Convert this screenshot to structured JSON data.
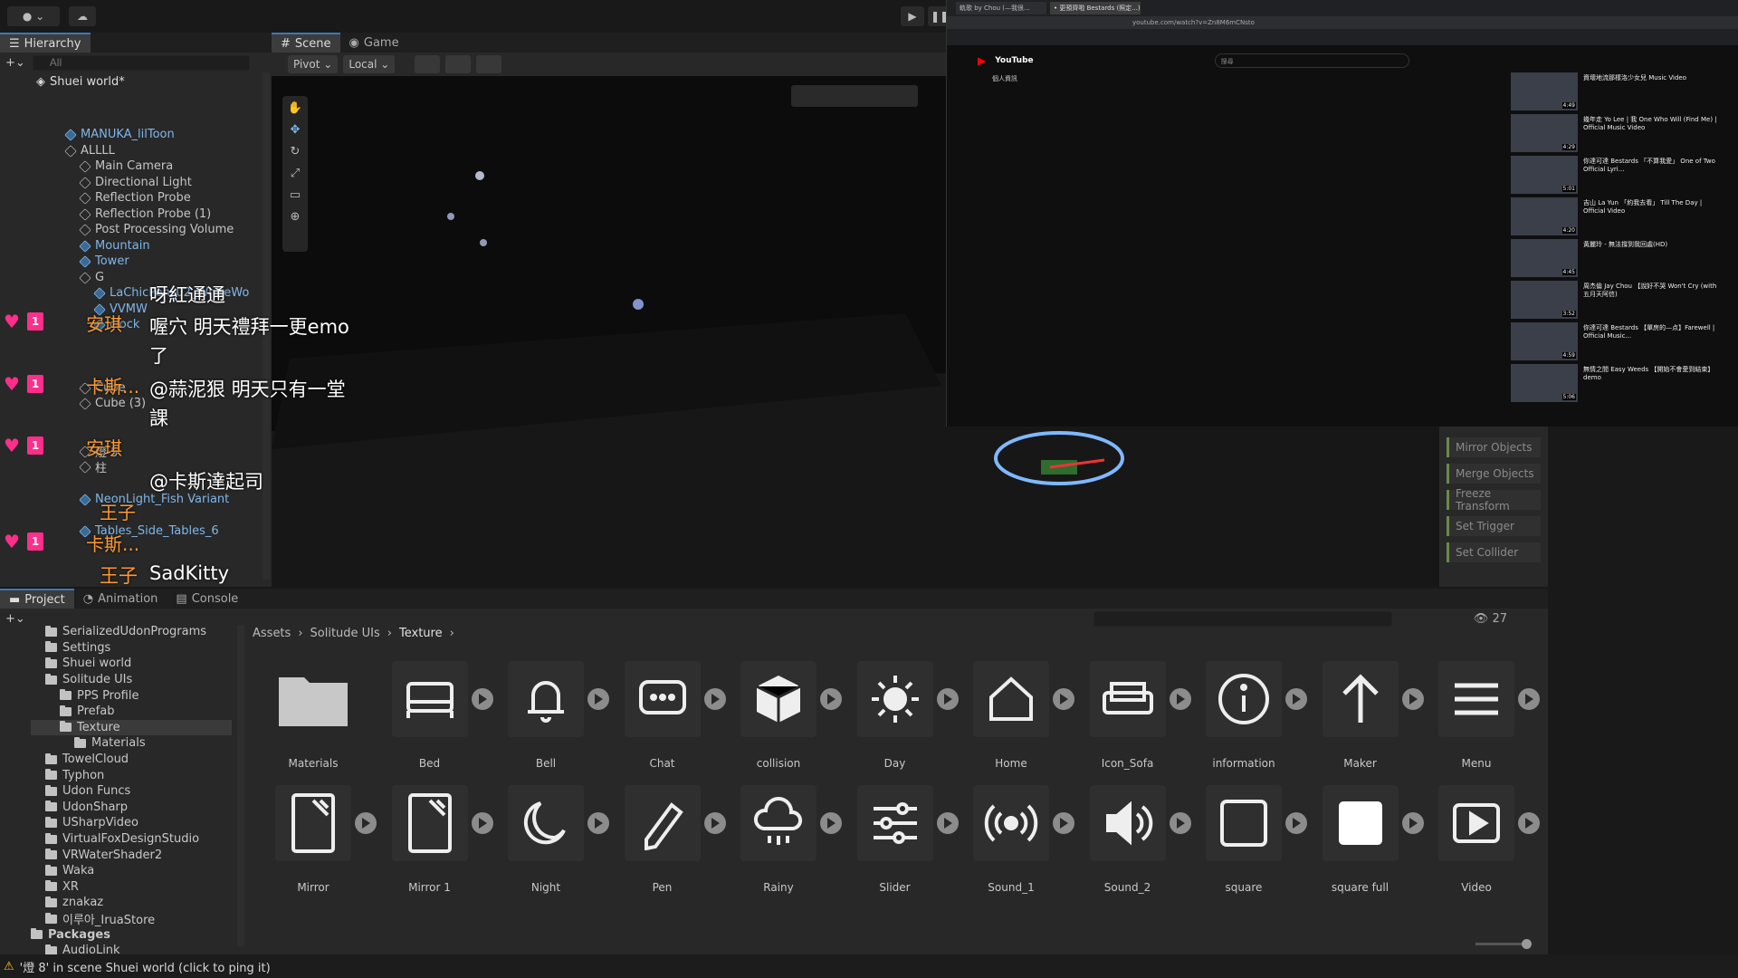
{
  "toolbar": {
    "play_icon": "play-icon",
    "pause_icon": "pause-icon"
  },
  "hierarchy": {
    "tab_label": "Hierarchy",
    "search_placeholder": "All",
    "scene_name": "Shuei world*",
    "rows": [
      {
        "label": "MANUKA_lilToon",
        "indent": 1,
        "prefab": true
      },
      {
        "label": "ALLLL",
        "indent": 1,
        "prefab": false
      },
      {
        "label": "Main Camera",
        "indent": 2,
        "prefab": false
      },
      {
        "label": "Directional Light",
        "indent": 2,
        "prefab": false
      },
      {
        "label": "Reflection Probe",
        "indent": 2,
        "prefab": false
      },
      {
        "label": "Reflection Probe (1)",
        "indent": 2,
        "prefab": false
      },
      {
        "label": "Post Processing Volume",
        "indent": 2,
        "prefab": false
      },
      {
        "label": "Mountain",
        "indent": 2,
        "prefab": true
      },
      {
        "label": "Tower",
        "indent": 2,
        "prefab": true
      },
      {
        "label": "G",
        "indent": 2,
        "prefab": false
      },
      {
        "label": "LaChicPen_02_WhiteWo",
        "indent": 3,
        "prefab": true
      },
      {
        "label": "VVMW",
        "indent": 3,
        "prefab": true
      },
      {
        "label": "clock",
        "indent": 3,
        "prefab": true
      },
      {
        "label": "Cube",
        "indent": 2,
        "prefab": false
      },
      {
        "label": "Cube (3)",
        "indent": 2,
        "prefab": false
      },
      {
        "label": "燈 5",
        "indent": 2,
        "prefab": false
      },
      {
        "label": "柱",
        "indent": 2,
        "prefab": false
      },
      {
        "label": "NeonLight_Fish Variant",
        "indent": 2,
        "prefab": true
      },
      {
        "label": "Tables_Side_Tables_6",
        "indent": 2,
        "prefab": true
      }
    ]
  },
  "chat": [
    {
      "name": "",
      "text": "呀紅通通"
    },
    {
      "name": "安琪",
      "text": "喔穴 明天禮拜一更emo"
    },
    {
      "name": "",
      "text": "了"
    },
    {
      "name": "卡斯...",
      "text": "@蒜泥狠 明天只有一堂"
    },
    {
      "name": "",
      "text": "課"
    },
    {
      "name": "安琪",
      "text": ""
    },
    {
      "name": "",
      "text": "@卡斯達起司"
    },
    {
      "name": "王子",
      "text": ""
    },
    {
      "name": "卡斯...",
      "text": ""
    },
    {
      "name": "王子",
      "text": "SadKitty"
    }
  ],
  "scene": {
    "tab_scene": "Scene",
    "tab_game": "Game",
    "pivot": "Pivot",
    "local": "Local"
  },
  "youtube": {
    "url": "youtube.com/watch?v=Zn8M6mCNsto",
    "tab1": "軌歌 by Chou (—我很...",
    "tab2": "• 更預齊啦 Bestards (照定...)",
    "logo": "YouTube",
    "search_placeholder": "搜尋",
    "description_title": "個人資訊",
    "videos": [
      {
        "title": "資壞地流那樣洛少女兒 Music Video",
        "duration": "4:49"
      },
      {
        "title": "幾年走 Yo Lee | 我 One Who Will (Find Me) | Official Music Video",
        "duration": "4:29"
      },
      {
        "title": "你達可達 Bestards 「不算我愛」 One of Two Official Lyri...",
        "duration": "5:01"
      },
      {
        "title": "吉山 La Yun 「約我去看」 Till The Day | Official Video",
        "duration": "4:20"
      },
      {
        "title": "黃麗玲 - 無法撐到我回處(HD)",
        "duration": "4:45"
      },
      {
        "title": "周杰倫 Jay Chou 【說好不哭 Won't Cry (with 五月天阿信)",
        "duration": "3:52"
      },
      {
        "title": "你達可達 Bestards 【單房的—点】Farewell | Official Music...",
        "duration": "4:59"
      },
      {
        "title": "無情之間 Easy Weeds 【開始不會愛到結束】 demo",
        "duration": "5:06"
      }
    ]
  },
  "tools": {
    "items": [
      "Mirror Objects",
      "Merge Objects",
      "Freeze Transform",
      "Set Trigger",
      "Set Collider"
    ]
  },
  "project": {
    "tab_project": "Project",
    "tab_animation": "Animation",
    "tab_console": "Console",
    "breadcrumb": [
      "Assets",
      "Solitude UIs",
      "Texture"
    ],
    "hidden_count": "27",
    "tree": [
      {
        "label": "SerializedUdonPrograms",
        "indent": 1
      },
      {
        "label": "Settings",
        "indent": 1
      },
      {
        "label": "Shuei world",
        "indent": 1
      },
      {
        "label": "Solitude UIs",
        "indent": 1
      },
      {
        "label": "PPS Profile",
        "indent": 2
      },
      {
        "label": "Prefab",
        "indent": 2
      },
      {
        "label": "Texture",
        "indent": 2
      },
      {
        "label": "Materials",
        "indent": 3
      },
      {
        "label": "TowelCloud",
        "indent": 1
      },
      {
        "label": "Typhon",
        "indent": 1
      },
      {
        "label": "Udon Funcs",
        "indent": 1
      },
      {
        "label": "UdonSharp",
        "indent": 1
      },
      {
        "label": "USharpVideo",
        "indent": 1
      },
      {
        "label": "VirtualFoxDesignStudio",
        "indent": 1
      },
      {
        "label": "VRWaterShader2",
        "indent": 1
      },
      {
        "label": "Waka",
        "indent": 1
      },
      {
        "label": "XR",
        "indent": 1
      },
      {
        "label": "znakaz",
        "indent": 1
      },
      {
        "label": "이루아_IruaStore",
        "indent": 1
      },
      {
        "label": "Packages",
        "indent": 0
      },
      {
        "label": "AudioLink",
        "indent": 1
      }
    ],
    "assets_row1": [
      {
        "label": "Materials",
        "icon": "folder-icon"
      },
      {
        "label": "Bed",
        "icon": "bed-icon"
      },
      {
        "label": "Bell",
        "icon": "bell-icon"
      },
      {
        "label": "Chat",
        "icon": "chat-icon"
      },
      {
        "label": "collision",
        "icon": "cube-icon"
      },
      {
        "label": "Day",
        "icon": "sun-icon"
      },
      {
        "label": "Home",
        "icon": "home-icon"
      },
      {
        "label": "Icon_Sofa",
        "icon": "sofa-icon"
      },
      {
        "label": "information",
        "icon": "info-icon"
      },
      {
        "label": "Maker",
        "icon": "arrow-up-icon"
      },
      {
        "label": "Menu",
        "icon": "menu-icon"
      }
    ],
    "assets_row2": [
      {
        "label": "Mirror",
        "icon": "mirror-icon"
      },
      {
        "label": "Mirror 1",
        "icon": "mirror-icon"
      },
      {
        "label": "Night",
        "icon": "moon-icon"
      },
      {
        "label": "Pen",
        "icon": "pen-icon"
      },
      {
        "label": "Rainy",
        "icon": "rain-icon"
      },
      {
        "label": "Slider",
        "icon": "slider-icon"
      },
      {
        "label": "Sound_1",
        "icon": "broadcast-icon"
      },
      {
        "label": "Sound_2",
        "icon": "speaker-icon"
      },
      {
        "label": "square",
        "icon": "square-icon"
      },
      {
        "label": "square full",
        "icon": "square-full-icon"
      },
      {
        "label": "Video",
        "icon": "video-icon"
      }
    ]
  },
  "status": {
    "message": "'燈 8' in scene Shuei world (click to ping it)"
  }
}
